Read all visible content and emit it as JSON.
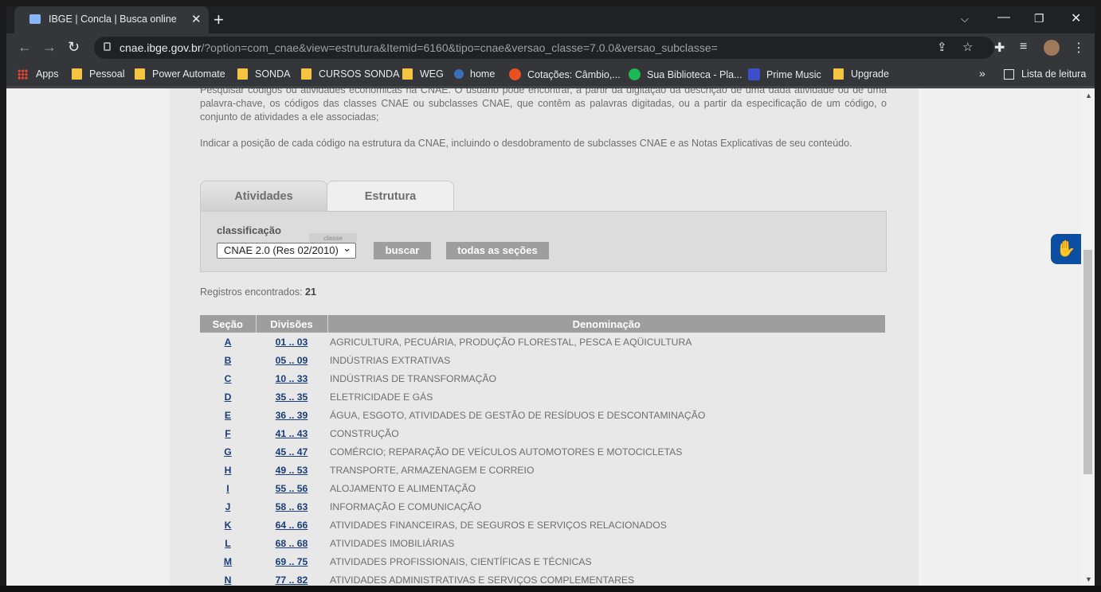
{
  "browser": {
    "tab_title": "IBGE | Concla | Busca online",
    "tab_close": "✕",
    "new_tab": "+",
    "url_host": "cnae.ibge.gov.br",
    "url_path": "/?option=com_cnae&view=estrutura&Itemid=6160&tipo=cnae&versao_classe=7.0.0&versao_subclasse="
  },
  "bookmarks": {
    "apps": "Apps",
    "items": [
      "Pessoal",
      "Power Automate",
      "SONDA",
      "CURSOS SONDA",
      "WEG",
      "home",
      "Cotações: Câmbio,...",
      "Sua Biblioteca - Pla...",
      "Prime Music",
      "Upgrade"
    ],
    "more": "»",
    "reading_list": "Lista de leitura"
  },
  "page": {
    "intro_text": "Pesquisar códigos ou atividades econômicas na CNAE. O usuário pode encontrar, a partir da digitação da descrição de uma dada atividade ou de uma palavra-chave, os códigos das classes CNAE ou subclasses CNAE, que contêm as palavras digitadas, ou a partir da especificação de um código, o conjunto de atividades a ele associadas;",
    "intro_text_2": "Indicar a posição de cada código na estrutura da CNAE, incluindo o desdobramento de subclasses CNAE e as Notas Explicativas de seu conteúdo.",
    "tabs": [
      "Atividades",
      "Estrutura"
    ],
    "active_tab": "Estrutura",
    "classificacao_label": "classificação",
    "classe_tag": "classe",
    "select_value": "CNAE 2.0 (Res 02/2010)",
    "buscar_label": "buscar",
    "todas_label": "todas as seções",
    "registros_label": "Registros encontrados:",
    "registros_count": "21"
  },
  "table": {
    "headers": [
      "Seção",
      "Divisões",
      "Denominação"
    ],
    "rows": [
      {
        "sec": "A",
        "div": "01 .. 03",
        "den": "AGRICULTURA, PECUÁRIA, PRODUÇÃO FLORESTAL, PESCA E AQÜICULTURA"
      },
      {
        "sec": "B",
        "div": "05 .. 09",
        "den": "INDÚSTRIAS EXTRATIVAS"
      },
      {
        "sec": "C",
        "div": "10 .. 33",
        "den": "INDÚSTRIAS DE TRANSFORMAÇÃO"
      },
      {
        "sec": "D",
        "div": "35 .. 35",
        "den": "ELETRICIDADE E GÁS"
      },
      {
        "sec": "E",
        "div": "36 .. 39",
        "den": "ÁGUA, ESGOTO, ATIVIDADES DE GESTÃO DE RESÍDUOS E DESCONTAMINAÇÃO"
      },
      {
        "sec": "F",
        "div": "41 .. 43",
        "den": "CONSTRUÇÃO"
      },
      {
        "sec": "G",
        "div": "45 .. 47",
        "den": "COMÉRCIO; REPARAÇÃO DE VEÍCULOS AUTOMOTORES E MOTOCICLETAS"
      },
      {
        "sec": "H",
        "div": "49 .. 53",
        "den": "TRANSPORTE, ARMAZENAGEM E CORREIO"
      },
      {
        "sec": "I",
        "div": "55 .. 56",
        "den": "ALOJAMENTO E ALIMENTAÇÃO"
      },
      {
        "sec": "J",
        "div": "58 .. 63",
        "den": "INFORMAÇÃO E COMUNICAÇÃO"
      },
      {
        "sec": "K",
        "div": "64 .. 66",
        "den": "ATIVIDADES FINANCEIRAS, DE SEGUROS E SERVIÇOS RELACIONADOS"
      },
      {
        "sec": "L",
        "div": "68 .. 68",
        "den": "ATIVIDADES IMOBILIÁRIAS"
      },
      {
        "sec": "M",
        "div": "69 .. 75",
        "den": "ATIVIDADES PROFISSIONAIS, CIENTÍFICAS E TÉCNICAS"
      },
      {
        "sec": "N",
        "div": "77 .. 82",
        "den": "ATIVIDADES ADMINISTRATIVAS E SERVIÇOS COMPLEMENTARES"
      }
    ]
  },
  "icons": {
    "back": "arrow-left-icon",
    "forward": "arrow-right-icon",
    "reload": "reload-icon",
    "share": "share-icon",
    "star": "star-icon",
    "extensions": "puzzle-icon",
    "media": "media-queue-icon",
    "menu": "kebab-menu-icon",
    "accessibility": "vlibras-hands-icon"
  }
}
